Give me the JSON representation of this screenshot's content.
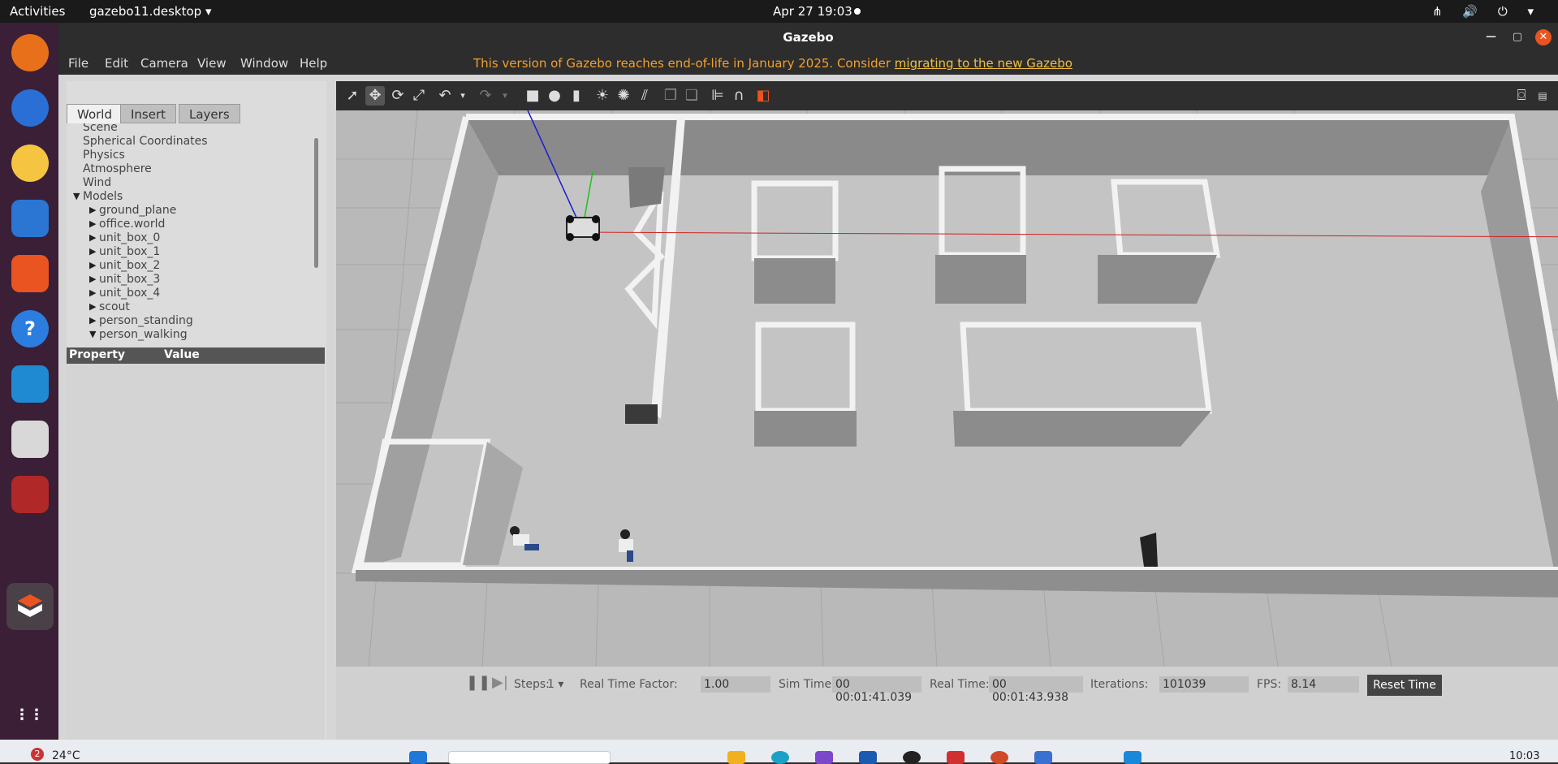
{
  "topbar": {
    "activities": "Activities",
    "app_menu": "gazebo11.desktop ▾",
    "clock": "Apr 27  19:03",
    "tray": "⋔ 🔊 ⏻ ▾"
  },
  "window": {
    "title": "Gazebo",
    "minimize": "—",
    "maximize": "▢",
    "close": "✕"
  },
  "menu": {
    "file": "File",
    "edit": "Edit",
    "camera": "Camera",
    "view": "View",
    "window": "Window",
    "help": "Help",
    "notice": "This version of Gazebo reaches end-of-life in January 2025. Consider ",
    "notice_link": "migrating to the new Gazebo"
  },
  "tabs": {
    "world": "World",
    "insert": "Insert",
    "layers": "Layers"
  },
  "tree": {
    "scene": "Scene",
    "spherical": "Spherical Coordinates",
    "physics": "Physics",
    "atmosphere": "Atmosphere",
    "wind": "Wind",
    "models": "Models",
    "items": [
      "ground_plane",
      "office.world",
      "unit_box_0",
      "unit_box_1",
      "unit_box_2",
      "unit_box_3",
      "unit_box_4",
      "scout",
      "person_standing",
      "person_walking"
    ]
  },
  "props": {
    "property": "Property",
    "value": "Value"
  },
  "status": {
    "steps_label": "Steps:",
    "steps_value": "1 ▾",
    "rtf_label": "Real Time Factor:",
    "rtf_value": "1.00",
    "sim_label": "Sim Time:",
    "sim_value": "00 00:01:41.039",
    "real_label": "Real Time:",
    "real_value": "00 00:01:43.938",
    "iter_label": "Iterations:",
    "iter_value": "101039",
    "fps_label": "FPS:",
    "fps_value": "8.14",
    "reset": "Reset Time"
  },
  "taskbar": {
    "badge": "2",
    "weather": "24°C",
    "time": "10:03"
  },
  "colors": {
    "accent": "#e95420",
    "notice": "#f0a030",
    "dock": "#3a1f37"
  }
}
